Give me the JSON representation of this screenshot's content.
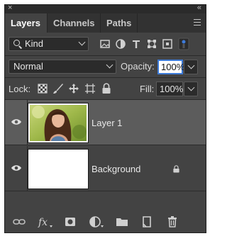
{
  "window": {
    "close_glyph": "×",
    "collapse_glyph": "«"
  },
  "tabs": [
    {
      "label": "Layers",
      "active": true
    },
    {
      "label": "Channels",
      "active": false
    },
    {
      "label": "Paths",
      "active": false
    }
  ],
  "filter": {
    "kind_label": "Kind",
    "icons": [
      "image-filter-icon",
      "adjustment-filter-icon",
      "type-filter-icon",
      "shape-filter-icon",
      "smart-object-filter-icon",
      "filter-toggle-icon"
    ]
  },
  "blend": {
    "mode": "Normal",
    "opacity_label": "Opacity:",
    "opacity_value": "100%"
  },
  "lock": {
    "label": "Lock:",
    "icons": [
      "lock-transparent-pixels-icon",
      "lock-image-pixels-icon",
      "lock-position-icon",
      "lock-artboard-icon",
      "lock-all-icon"
    ],
    "fill_label": "Fill:",
    "fill_value": "100%"
  },
  "layers": [
    {
      "name": "Layer 1",
      "selected": true,
      "visible": true,
      "locked": false,
      "thumbnail": "photo-portrait"
    },
    {
      "name": "Background",
      "selected": false,
      "visible": true,
      "locked": true,
      "thumbnail": "white"
    }
  ],
  "bottom_icons": [
    "link-layers-icon",
    "fx-icon",
    "add-mask-icon",
    "adjustment-layer-icon",
    "new-group-icon",
    "new-layer-icon",
    "delete-icon"
  ],
  "colors": {
    "panel_bg": "#434343",
    "selected_row": "#5c5c5c",
    "focus_border": "#3d7bd9"
  }
}
